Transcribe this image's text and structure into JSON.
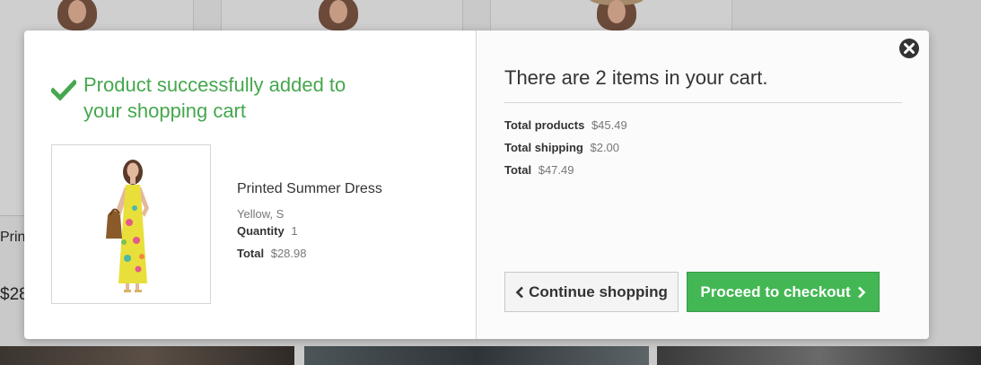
{
  "background": {
    "partial_texts": [
      "Print",
      "$28"
    ]
  },
  "modal": {
    "success_message": "Product successfully added to your shopping cart",
    "product": {
      "name": "Printed Summer Dress",
      "attributes": "Yellow, S",
      "quantity_label": "Quantity",
      "quantity": "1",
      "total_label": "Total",
      "total": "$28.98"
    },
    "cart": {
      "heading": "There are 2 items in your cart.",
      "total_products_label": "Total products",
      "total_products": "$45.49",
      "total_shipping_label": "Total shipping",
      "total_shipping": "$2.00",
      "total_label": "Total",
      "total": "$47.49"
    },
    "buttons": {
      "continue": "Continue shopping",
      "checkout": "Proceed to checkout"
    },
    "icons": {
      "success": "check-icon",
      "close": "close-icon",
      "back": "chevron-left-icon",
      "forward": "chevron-right-icon"
    },
    "colors": {
      "success_green": "#46a74e",
      "checkout_button": "#43b754"
    }
  }
}
